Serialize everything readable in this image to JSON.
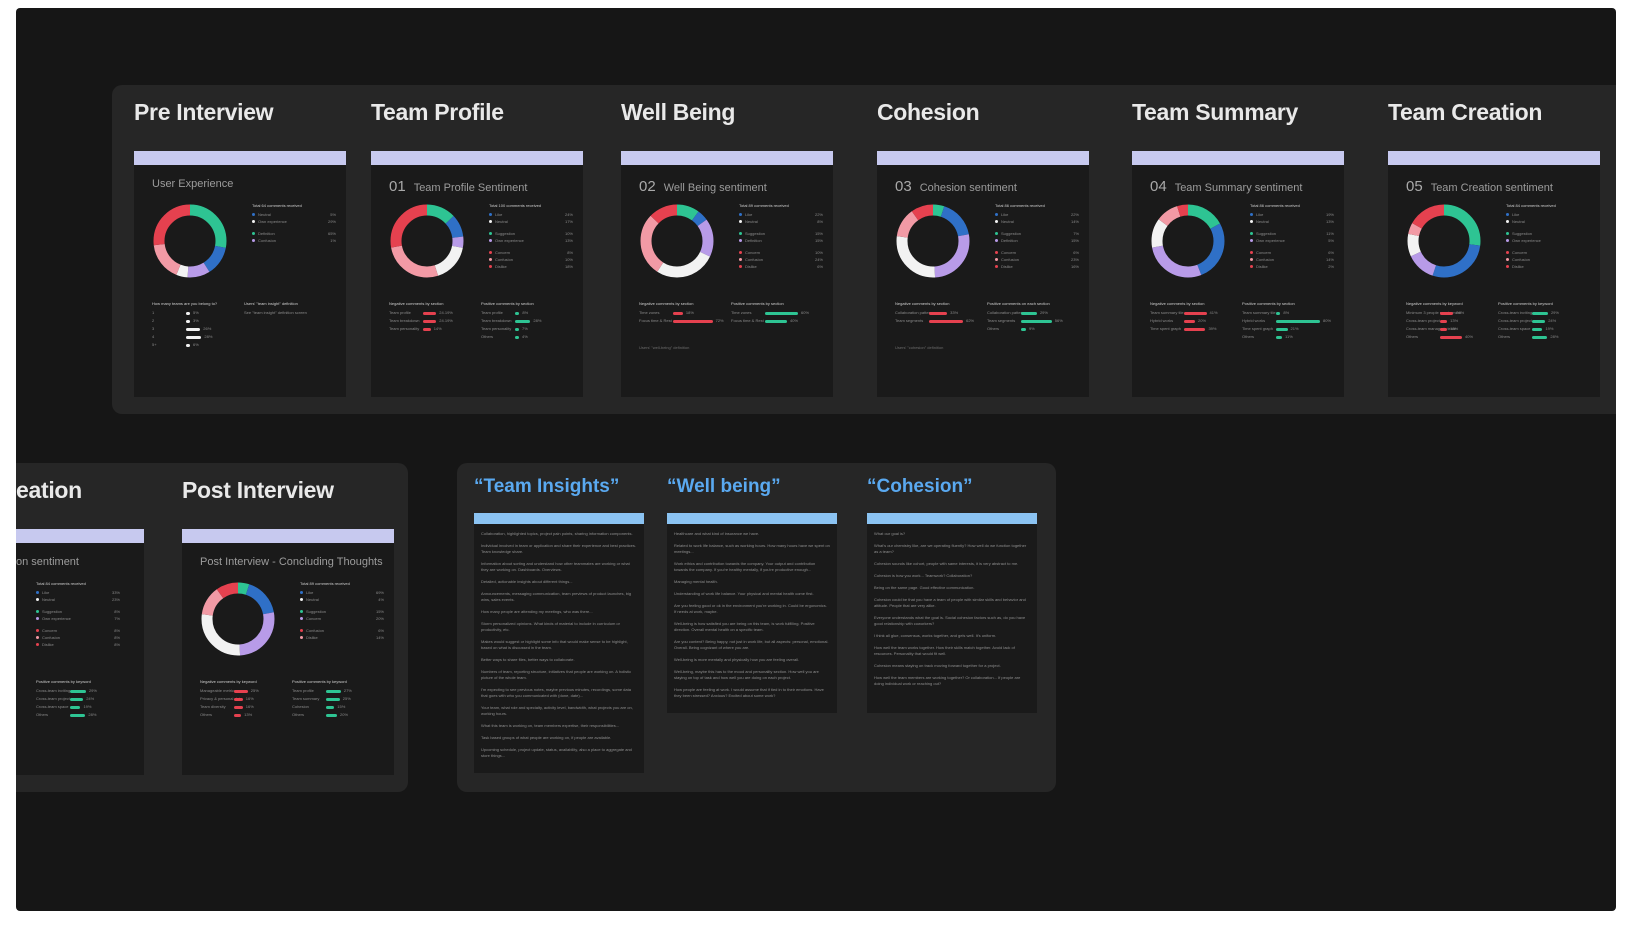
{
  "colors": {
    "canvas": "#161616",
    "panel": "#262626",
    "card": "#1a1a1a",
    "card_bar": "#c7c9ef",
    "kw_bar": "#8bc3f2",
    "red": "#e5414f",
    "pink": "#f29aa5",
    "teal": "#2ec493",
    "blue": "#2f70c7",
    "lilac": "#b89be8",
    "white": "#f2f2f2"
  },
  "top": [
    {
      "title": "Pre Interview",
      "num": "",
      "card_title": "User Experience",
      "legend_title": "Total 64 comments received",
      "legend": [
        [
          "Neutral",
          "5%"
        ],
        [
          "Own experience",
          "29%"
        ],
        [
          "Definition",
          "65%"
        ],
        [
          "Confusion",
          "1%"
        ]
      ],
      "left_title": "How many teams are you belong to?",
      "left_rows": [
        [
          "1",
          "5%"
        ],
        [
          "2",
          "3%"
        ],
        [
          "3",
          "26%"
        ],
        [
          "4",
          "28%"
        ],
        [
          "5+",
          "6%"
        ]
      ],
      "right_title": "Users' \"team insight\" definition",
      "right_rows": [
        [
          "See \"team insight\" definition screen",
          ""
        ]
      ]
    },
    {
      "title": "Team Profile",
      "num": "01",
      "card_title": "Team Profile Sentiment",
      "legend_title": "Total 100 comments received",
      "legend": [
        [
          "Like",
          "24%"
        ],
        [
          "Neutral",
          "17%"
        ],
        [
          "Suggestion",
          "10%"
        ],
        [
          "Own experience",
          "13%"
        ],
        [
          "Concern",
          "8%"
        ],
        [
          "Confusion",
          "10%"
        ],
        [
          "Dislike",
          "18%"
        ]
      ],
      "left_title": "Negative comments by section",
      "left_rows": [
        [
          "Team profile",
          "24.19%"
        ],
        [
          "Team breakdown",
          "24.19%"
        ],
        [
          "Team personality",
          "14%"
        ]
      ],
      "right_title": "Positive comments by section",
      "right_rows": [
        [
          "Team profile",
          "8%"
        ],
        [
          "Team breakdown",
          "28%"
        ],
        [
          "Team personality",
          "7%"
        ],
        [
          "Others",
          "4%"
        ]
      ]
    },
    {
      "title": "Well Being",
      "num": "02",
      "card_title": "Well Being sentiment",
      "legend_title": "Total 89 comments received",
      "legend": [
        [
          "Like",
          "22%"
        ],
        [
          "Neutral",
          "8%"
        ],
        [
          "Suggestion",
          "15%"
        ],
        [
          "Definition",
          "15%"
        ],
        [
          "Concern",
          "10%"
        ],
        [
          "Confusion",
          "24%"
        ],
        [
          "Dislike",
          "6%"
        ]
      ],
      "left_title": "Negative comments by section",
      "left_rows": [
        [
          "Time zones",
          "18%"
        ],
        [
          "Focus time & Rest",
          "72%"
        ]
      ],
      "right_title": "Positive comments by section",
      "right_rows": [
        [
          "Time zones",
          "60%"
        ],
        [
          "Focus time & Rest",
          "40%"
        ]
      ],
      "extra": "Users' \"well-being\" definition"
    },
    {
      "title": "Cohesion",
      "num": "03",
      "card_title": "Cohesion sentiment",
      "legend_title": "Total 86 comments received",
      "legend": [
        [
          "Like",
          "22%"
        ],
        [
          "Neutral",
          "14%"
        ],
        [
          "Suggestion",
          "7%"
        ],
        [
          "Definition",
          "15%"
        ],
        [
          "Concern",
          "6%"
        ],
        [
          "Confusion",
          "23%"
        ],
        [
          "Dislike",
          "16%"
        ]
      ],
      "left_title": "Negative comments by section",
      "left_rows": [
        [
          "Collaboration pattern",
          "33%"
        ],
        [
          "Team segments",
          "62%"
        ]
      ],
      "right_title": "Positive comments on each section",
      "right_rows": [
        [
          "Collaboration pattern",
          "29%"
        ],
        [
          "Team segments",
          "56%"
        ],
        [
          "Others",
          "9%"
        ]
      ],
      "extra": "Users' \"cohesion\" definition"
    },
    {
      "title": "Team Summary",
      "num": "04",
      "card_title": "Team Summary sentiment",
      "legend_title": "Total 86 comments received",
      "legend": [
        [
          "Like",
          "19%"
        ],
        [
          "Neutral",
          "13%"
        ],
        [
          "Suggestion",
          "11%"
        ],
        [
          "Own experience",
          "5%"
        ],
        [
          "Concern",
          "6%"
        ],
        [
          "Confusion",
          "14%"
        ],
        [
          "Dislike",
          "2%"
        ]
      ],
      "left_title": "Negative comments by section",
      "left_rows": [
        [
          "Team summary tile",
          "41%"
        ],
        [
          "Hybrid works",
          "20%"
        ],
        [
          "Time spent graph",
          "39%"
        ]
      ],
      "right_title": "Positive comments by section",
      "right_rows": [
        [
          "Team summary tile",
          "8%"
        ],
        [
          "Hybrid works",
          "80%"
        ],
        [
          "Time spent graph",
          "21%"
        ],
        [
          "Others",
          "11%"
        ]
      ]
    },
    {
      "title": "Team Creation",
      "num": "05",
      "card_title": "Team Creation sentiment",
      "legend_title": "Total 84 comments received",
      "legend": [
        [
          "Like",
          ""
        ],
        [
          "Neutral",
          ""
        ],
        [
          "Suggestion",
          ""
        ],
        [
          "Own experience",
          ""
        ],
        [
          "Concern",
          ""
        ],
        [
          "Confusion",
          ""
        ],
        [
          "Dislike",
          ""
        ]
      ],
      "left_title": "Negative comments by keyword",
      "left_rows": [
        [
          "Minimum 3 people requirement",
          "24%"
        ],
        [
          "Cross-team project",
          "13%"
        ],
        [
          "Cross-team manager's team",
          "13%"
        ],
        [
          "Others",
          "40%"
        ]
      ],
      "right_title": "Positive comments by keyword",
      "right_rows": [
        [
          "Cross-team inviting",
          "29%"
        ],
        [
          "Cross-team project",
          "24%"
        ],
        [
          "Cross-team space",
          "19%"
        ],
        [
          "Others",
          "28%"
        ]
      ]
    }
  ],
  "bottom_left": [
    {
      "title": "eation",
      "card_title": "on sentiment",
      "legend_title": "Total 84 comments received",
      "legend": [
        [
          "Like",
          "33%"
        ],
        [
          "Neutral",
          "23%"
        ],
        [
          "Suggestion",
          "8%"
        ],
        [
          "Own experience",
          "7%"
        ],
        [
          "Concern",
          "8%"
        ],
        [
          "Confusion",
          "8%"
        ],
        [
          "Dislike",
          "8%"
        ]
      ],
      "right_title": "Positive comments by keyword",
      "right_rows": [
        [
          "Cross-team inviting",
          "29%"
        ],
        [
          "Cross-team project",
          "24%"
        ],
        [
          "Cross-team space",
          "19%"
        ],
        [
          "Others",
          "28%"
        ]
      ]
    },
    {
      "title": "Post Interview",
      "card_title": "Post Interview - Concluding Thoughts",
      "legend_title": "Total 89 comments received",
      "legend": [
        [
          "Like",
          "69%"
        ],
        [
          "Neutral",
          "4%"
        ],
        [
          "Suggestion",
          "15%"
        ],
        [
          "Concern",
          "20%"
        ],
        [
          "Confusion",
          "6%"
        ],
        [
          "Dislike",
          "14%"
        ]
      ],
      "left_title": "Negative comments by keyword",
      "left_rows": [
        [
          "Manageable metrics",
          "25%"
        ],
        [
          "Privacy & personal data",
          "16%"
        ],
        [
          "Team diversity",
          "16%"
        ],
        [
          "Others",
          "13%"
        ]
      ],
      "right_title": "Positive comments by keyword",
      "right_rows": [
        [
          "Team profile",
          "27%"
        ],
        [
          "Team summary",
          "25%"
        ],
        [
          "Cohesion",
          "15%"
        ],
        [
          "Others",
          "20%"
        ]
      ]
    }
  ],
  "keywords": [
    {
      "title": "“Team Insights”",
      "lines": [
        "Collaboration, highlighted topics, project pain points, sharing information components.",
        "Individual involved in team or application and share their experience and best practices. Team knowledge share.",
        "Information about sorting and understand how other teammates are working or what they are working on. Dashboards. Overviews.",
        "Detailed, actionable insights about different things...",
        "Announcements, messaging communication, team previews of product launches, big wins, sales events.",
        "How many people are attending my meetings, who was there...",
        "Storm personalized opinions. What kinds of material to include in curriculum or productivity, etc.",
        "Makes would suggest or highlight some info that would make sense to be highlight, based on what is discussed in the team.",
        "Better ways to share files, better ways to collaborate.",
        "Numbers of team, reporting structure, initiatives that people are working on. A holistic picture of the whole team.",
        "I'm expecting to see previous notes, maybe previous minutes, recordings, some data that goes with who you communicated with (done, date)...",
        "Your team, what role and specialty, activity level, bandwidth, what projects you are on, working hours.",
        "What this team is working on, team members expertise, their responsibilities...",
        "Task based groups of what people are working on, if people are available.",
        "Upcoming schedule, project update, status, availability, also a place to aggregate and store things..."
      ]
    },
    {
      "title": "“Well being”",
      "lines": [
        "Healthcare and what kind of insurance we have.",
        "Related to work life balance, such as working hours. How many hours have we spent on meetings...",
        "Work ethics and contribution towards the company. Your output and contribution towards the company. If you're healthy mentally, if you're productive enough...",
        "Managing mental health.",
        "Understanding of work life balance. Your physical and mental health come first.",
        "Are you feeling good or ok in the environment you're working in. Could be ergonomics. If needs at work, maybe.",
        "Well-being is how satisfied you are being on this team, is work fulfilling. Positive direction. Overall mental health on a specific team.",
        "Are you content? Being happy, not just in work life, but all aspects: personal, emotional. Overall. Being cognizant of where you are.",
        "Well-being is more mentally and physically how you are feeling overall.",
        "Well-being, maybe this has to the mood and personality section. How well you are staying on top of task and how well you are doing on each project.",
        "How people are feeling at work. I would assume that if tied in to their emotions. Have they been stressed? Anxious? Excited about some work?"
      ]
    },
    {
      "title": "“Cohesion”",
      "lines": [
        "What our goal is?",
        "What's our chemistry like, are we operating fluently? How well do we function together as a team?",
        "Cohesion sounds like cohort, people with same interests, it is very abstract to me.",
        "Cohesion is how you work... Teamwork? Collaboration?",
        "Being on the same page. Good effective communication.",
        "Cohesion could be that you have a team of people with similar skills and behavior and attitude. People that are very alike.",
        "Everyone understands what the goal is. Social cohesion factors such as, do you have good relationship with coworkers?",
        "I think all glue, consensus, works together, and gels well. It's uniform.",
        "How well the team works together. How their skills match together. Avoid lack of resources. Personality that would fit well.",
        "Cohesion means staying on track moving forward together for a project.",
        "How well the team members are working together? Or collaboration... If people are doing individual work or reaching out?"
      ]
    }
  ]
}
